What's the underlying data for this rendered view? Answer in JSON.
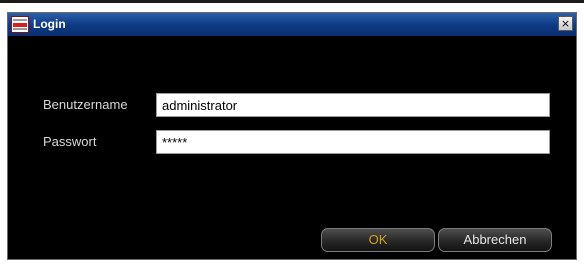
{
  "window": {
    "title": "Login",
    "close_glyph": "×",
    "icon": "app-logo-icon"
  },
  "form": {
    "username_label": "Benutzername",
    "username_value": "administrator",
    "password_label": "Passwort",
    "password_value": "*****"
  },
  "buttons": {
    "ok_label": "OK",
    "cancel_label": "Abbrechen"
  },
  "colors": {
    "titlebar": "#0f3c86",
    "dialog_background": "#000000",
    "ok_text": "#d4a020",
    "label_text": "#d8d8d8"
  }
}
